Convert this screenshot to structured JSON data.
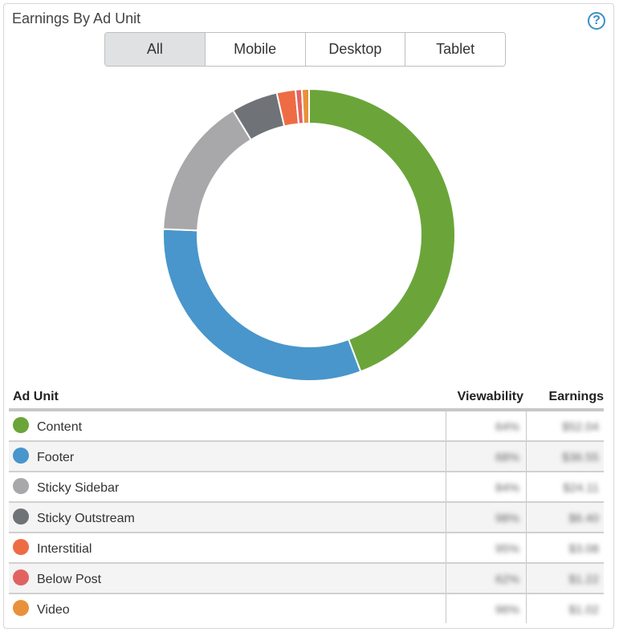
{
  "widget": {
    "title": "Earnings By Ad Unit",
    "help_icon": "question-circle-icon"
  },
  "tabs": [
    {
      "label": "All",
      "active": true
    },
    {
      "label": "Mobile",
      "active": false
    },
    {
      "label": "Desktop",
      "active": false
    },
    {
      "label": "Tablet",
      "active": false
    }
  ],
  "table": {
    "headers": {
      "ad_unit": "Ad Unit",
      "viewability": "Viewability",
      "earnings": "Earnings"
    },
    "rows": [
      {
        "name": "Content",
        "color": "#6ba539",
        "share": 0.447,
        "viewability": "64%",
        "earnings": "$52.04"
      },
      {
        "name": "Footer",
        "color": "#4896cb",
        "share": 0.317,
        "viewability": "68%",
        "earnings": "$36.55"
      },
      {
        "name": "Sticky Sidebar",
        "color": "#a8a8aa",
        "share": 0.158,
        "viewability": "84%",
        "earnings": "$24.11"
      },
      {
        "name": "Sticky Outstream",
        "color": "#6f7378",
        "share": 0.052,
        "viewability": "98%",
        "earnings": "$6.40"
      },
      {
        "name": "Interstitial",
        "color": "#ee6c44",
        "share": 0.021,
        "viewability": "95%",
        "earnings": "$3.08"
      },
      {
        "name": "Below Post",
        "color": "#e26262",
        "share": 0.007,
        "viewability": "62%",
        "earnings": "$1.22"
      },
      {
        "name": "Video",
        "color": "#e8913a",
        "share": 0.008,
        "viewability": "96%",
        "earnings": "$1.02"
      }
    ]
  }
}
